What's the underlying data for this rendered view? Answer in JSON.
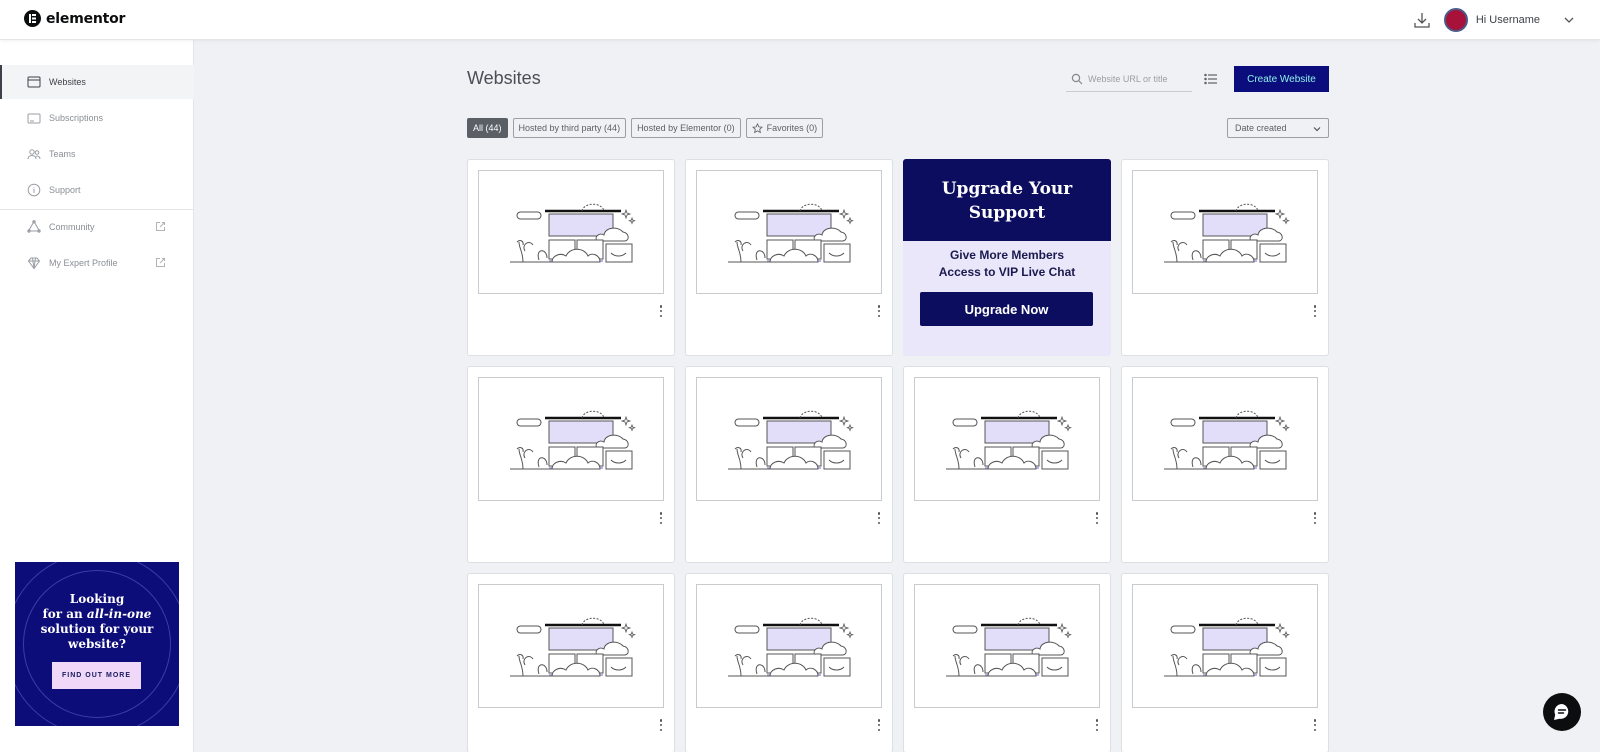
{
  "app": {
    "logo_text": "elementor"
  },
  "topbar": {
    "greeting": "Hi Username",
    "avatar_color": "#a8123a"
  },
  "sidebar": {
    "items": [
      {
        "label": "Websites",
        "icon": "browser-window-icon",
        "active": true
      },
      {
        "label": "Subscriptions",
        "icon": "card-icon"
      },
      {
        "label": "Teams",
        "icon": "users-icon"
      },
      {
        "label": "Support",
        "icon": "info-icon"
      },
      {
        "label": "Community",
        "icon": "community-icon",
        "external": true
      },
      {
        "label": "My Expert Profile",
        "icon": "diamond-icon",
        "external": true
      }
    ],
    "promo": {
      "line1": "Looking",
      "line2a": "for an ",
      "line2b": "all-in-one",
      "line3": "solution for your",
      "line4": "website?",
      "button": "FIND OUT MORE"
    }
  },
  "main": {
    "title": "Websites",
    "search_placeholder": "Website URL or title",
    "create_button": "Create Website",
    "filters": [
      {
        "label": "All (44)",
        "active": true
      },
      {
        "label": "Hosted by third party (44)"
      },
      {
        "label": "Hosted by Elementor (0)"
      },
      {
        "label": "Favorites (0)",
        "icon": "star-icon"
      }
    ],
    "sort_label": "Date created",
    "upgrade_card": {
      "title_line1": "Upgrade Your",
      "title_line2": "Support",
      "sub_line1": "Give More Members",
      "sub_line2": "Access to VIP Live Chat",
      "button": "Upgrade Now"
    }
  },
  "colors": {
    "brand_dark": "#0c0d5e",
    "create_button_bg": "#0c0d7d",
    "create_button_text": "#8ef0e8",
    "background": "#f0f1f4"
  }
}
